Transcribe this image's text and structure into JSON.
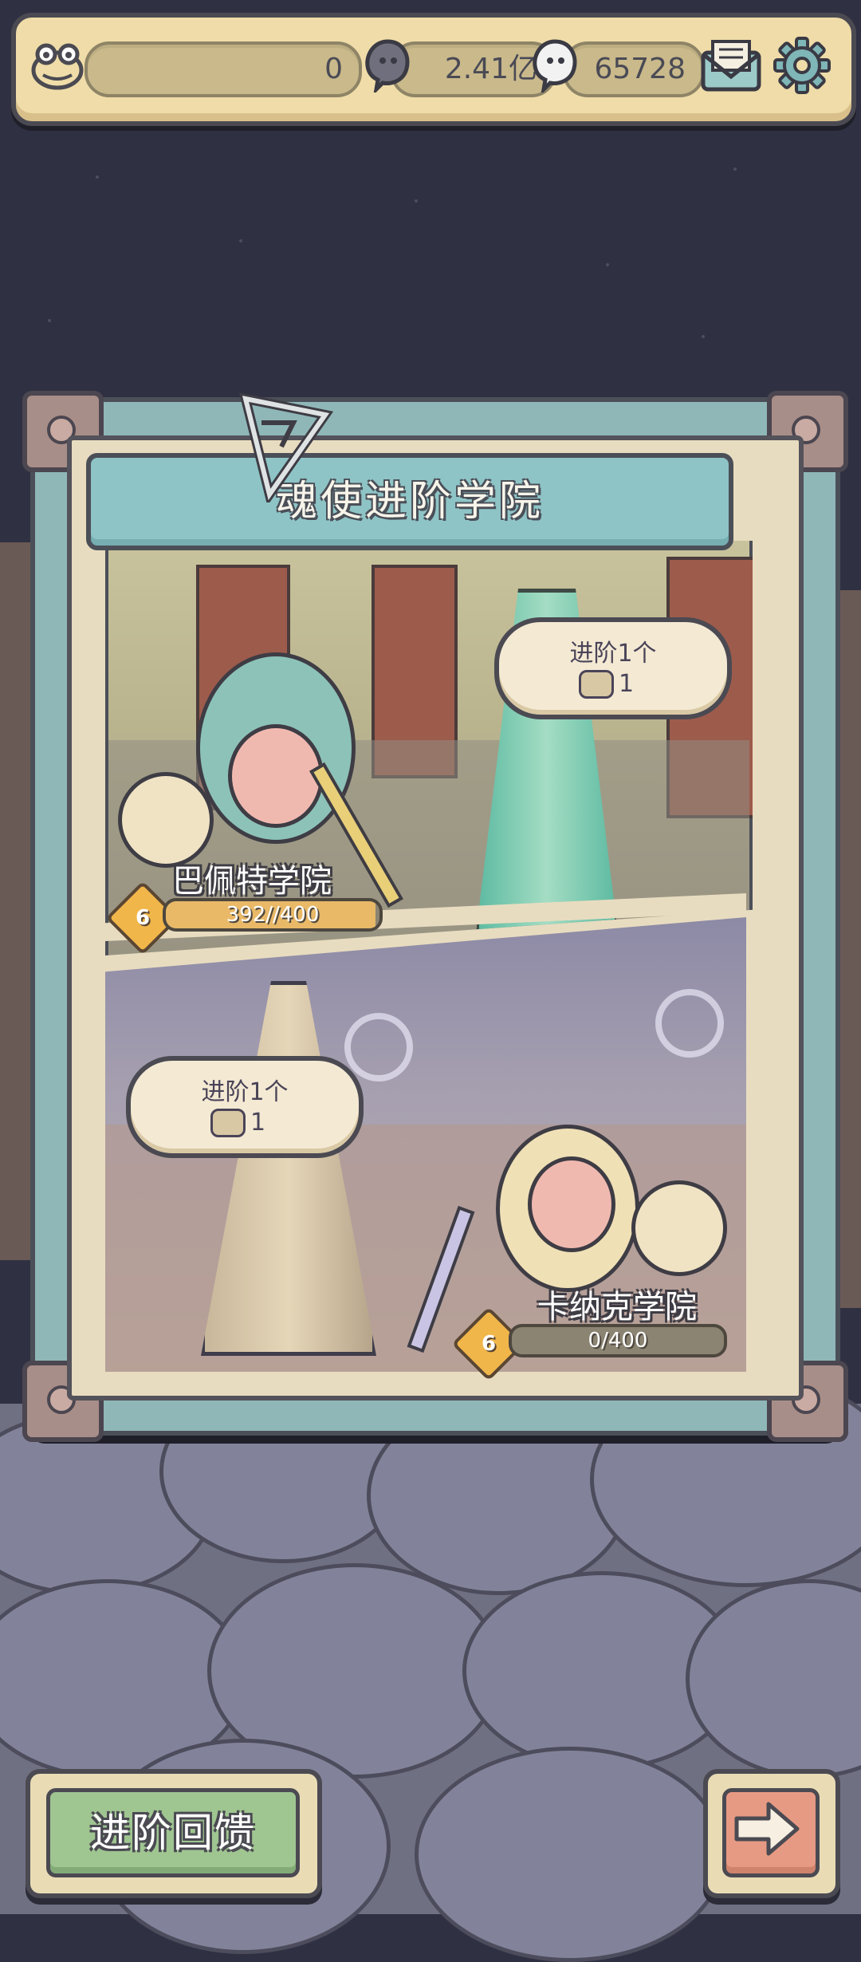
{
  "topbar": {
    "currency1_value": "0",
    "currency2_value": "2.41亿",
    "currency3_value": "65728",
    "icons": [
      "frog-avatar-icon",
      "soul-orb-icon",
      "white-soul-icon",
      "mail-icon",
      "gear-icon"
    ]
  },
  "panel": {
    "title": "魂使进阶学院",
    "academies": [
      {
        "name": "巴佩特学院",
        "level": "6",
        "progress_text": "392//400",
        "progress_value": 392,
        "progress_max": 400,
        "bubble_title": "进阶1个",
        "bubble_value": "1"
      },
      {
        "name": "卡纳克学院",
        "level": "6",
        "progress_text": "0/400",
        "progress_value": 0,
        "progress_max": 400,
        "bubble_title": "进阶1个",
        "bubble_value": "1"
      }
    ]
  },
  "bottom": {
    "feedback_label": "进阶回馈",
    "next_icon": "arrow-right-icon"
  },
  "colors": {
    "background": "#2f3142",
    "panel_teal": "#8fb7b8",
    "banner_teal": "#8ec4c6",
    "button_green": "#9fc591",
    "button_salmon": "#e79a83",
    "progress_orange": "#e9b968"
  }
}
